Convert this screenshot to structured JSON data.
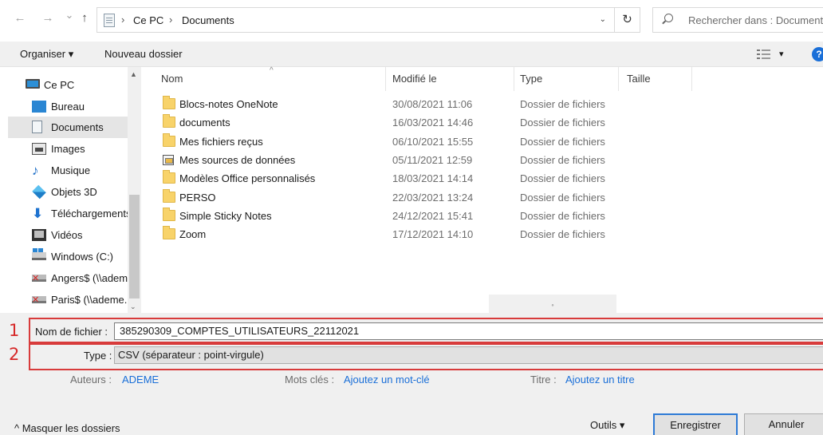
{
  "address_bar": {
    "back": "←",
    "forward": "→",
    "recent": "⌄",
    "up": "↑",
    "breadcrumbs": [
      "Ce PC",
      "Documents"
    ],
    "separator": "›",
    "dropdown": "⌄",
    "refresh": "↻",
    "search_placeholder": "Rechercher dans : Documents"
  },
  "toolbar": {
    "organize": "Organiser ▾",
    "new_folder": "Nouveau dossier",
    "view_dropdown": "▾",
    "help": "?"
  },
  "nav_pane": {
    "items": [
      {
        "label": "Ce PC",
        "icon": "computer-icon"
      },
      {
        "label": "Bureau",
        "icon": "desktop-icon"
      },
      {
        "label": "Documents",
        "icon": "documents-icon",
        "selected": true
      },
      {
        "label": "Images",
        "icon": "images-icon"
      },
      {
        "label": "Musique",
        "icon": "music-icon"
      },
      {
        "label": "Objets 3D",
        "icon": "3d-objects-icon"
      },
      {
        "label": "Téléchargements",
        "icon": "downloads-icon"
      },
      {
        "label": "Vidéos",
        "icon": "videos-icon"
      },
      {
        "label": "Windows (C:)",
        "icon": "drive-icon"
      },
      {
        "label": "Angers$ (\\\\ademe",
        "icon": "network-drive-icon"
      },
      {
        "label": "Paris$ (\\\\ademe.",
        "icon": "network-drive-icon"
      }
    ],
    "scroll_up": "▲",
    "scroll_down": "⌄",
    "music_glyph": "♪",
    "download_glyph": "⬇"
  },
  "file_list": {
    "columns": [
      "Nom",
      "Modifié le",
      "Type",
      "Taille"
    ],
    "sort_indicator": "^",
    "rows": [
      {
        "name": "Blocs-notes OneNote",
        "date": "30/08/2021 11:06",
        "type": "Dossier de fichiers",
        "icon": "folder-icon"
      },
      {
        "name": "documents",
        "date": "16/03/2021 14:46",
        "type": "Dossier de fichiers",
        "icon": "folder-icon"
      },
      {
        "name": "Mes fichiers reçus",
        "date": "06/10/2021 15:55",
        "type": "Dossier de fichiers",
        "icon": "folder-icon"
      },
      {
        "name": "Mes sources de données",
        "date": "05/11/2021 12:59",
        "type": "Dossier de fichiers",
        "icon": "data-source-icon"
      },
      {
        "name": "Modèles Office personnalisés",
        "date": "18/03/2021 14:14",
        "type": "Dossier de fichiers",
        "icon": "folder-icon"
      },
      {
        "name": "PERSO",
        "date": "22/03/2021 13:24",
        "type": "Dossier de fichiers",
        "icon": "folder-icon"
      },
      {
        "name": "Simple Sticky Notes",
        "date": "24/12/2021 15:41",
        "type": "Dossier de fichiers",
        "icon": "folder-icon"
      },
      {
        "name": "Zoom",
        "date": "17/12/2021 14:10",
        "type": "Dossier de fichiers",
        "icon": "folder-icon"
      }
    ],
    "hscroll_thumb": "◦"
  },
  "form": {
    "annotation_1": "1",
    "annotation_2": "2",
    "filename_label": "Nom de fichier :",
    "filename_value": "385290309_COMPTES_UTILISATEURS_22112021",
    "type_label": "Type :",
    "type_value": "CSV (séparateur : point-virgule)",
    "authors_label": "Auteurs :",
    "authors_value": "ADEME",
    "tags_label": "Mots clés :",
    "tags_value": "Ajoutez un mot-clé",
    "title_label": "Titre :",
    "title_value": "Ajoutez un titre",
    "hide_folders": "^ Masquer les dossiers",
    "tools": "Outils   ▾",
    "save": "Enregistrer",
    "cancel": "Annuler"
  },
  "colors": {
    "accent": "#2d7ad6",
    "link": "#1a6fd8",
    "annotation_red": "#d83b3b",
    "selected_bg": "#e5e5e5",
    "form_bg": "#f0f0f0"
  }
}
